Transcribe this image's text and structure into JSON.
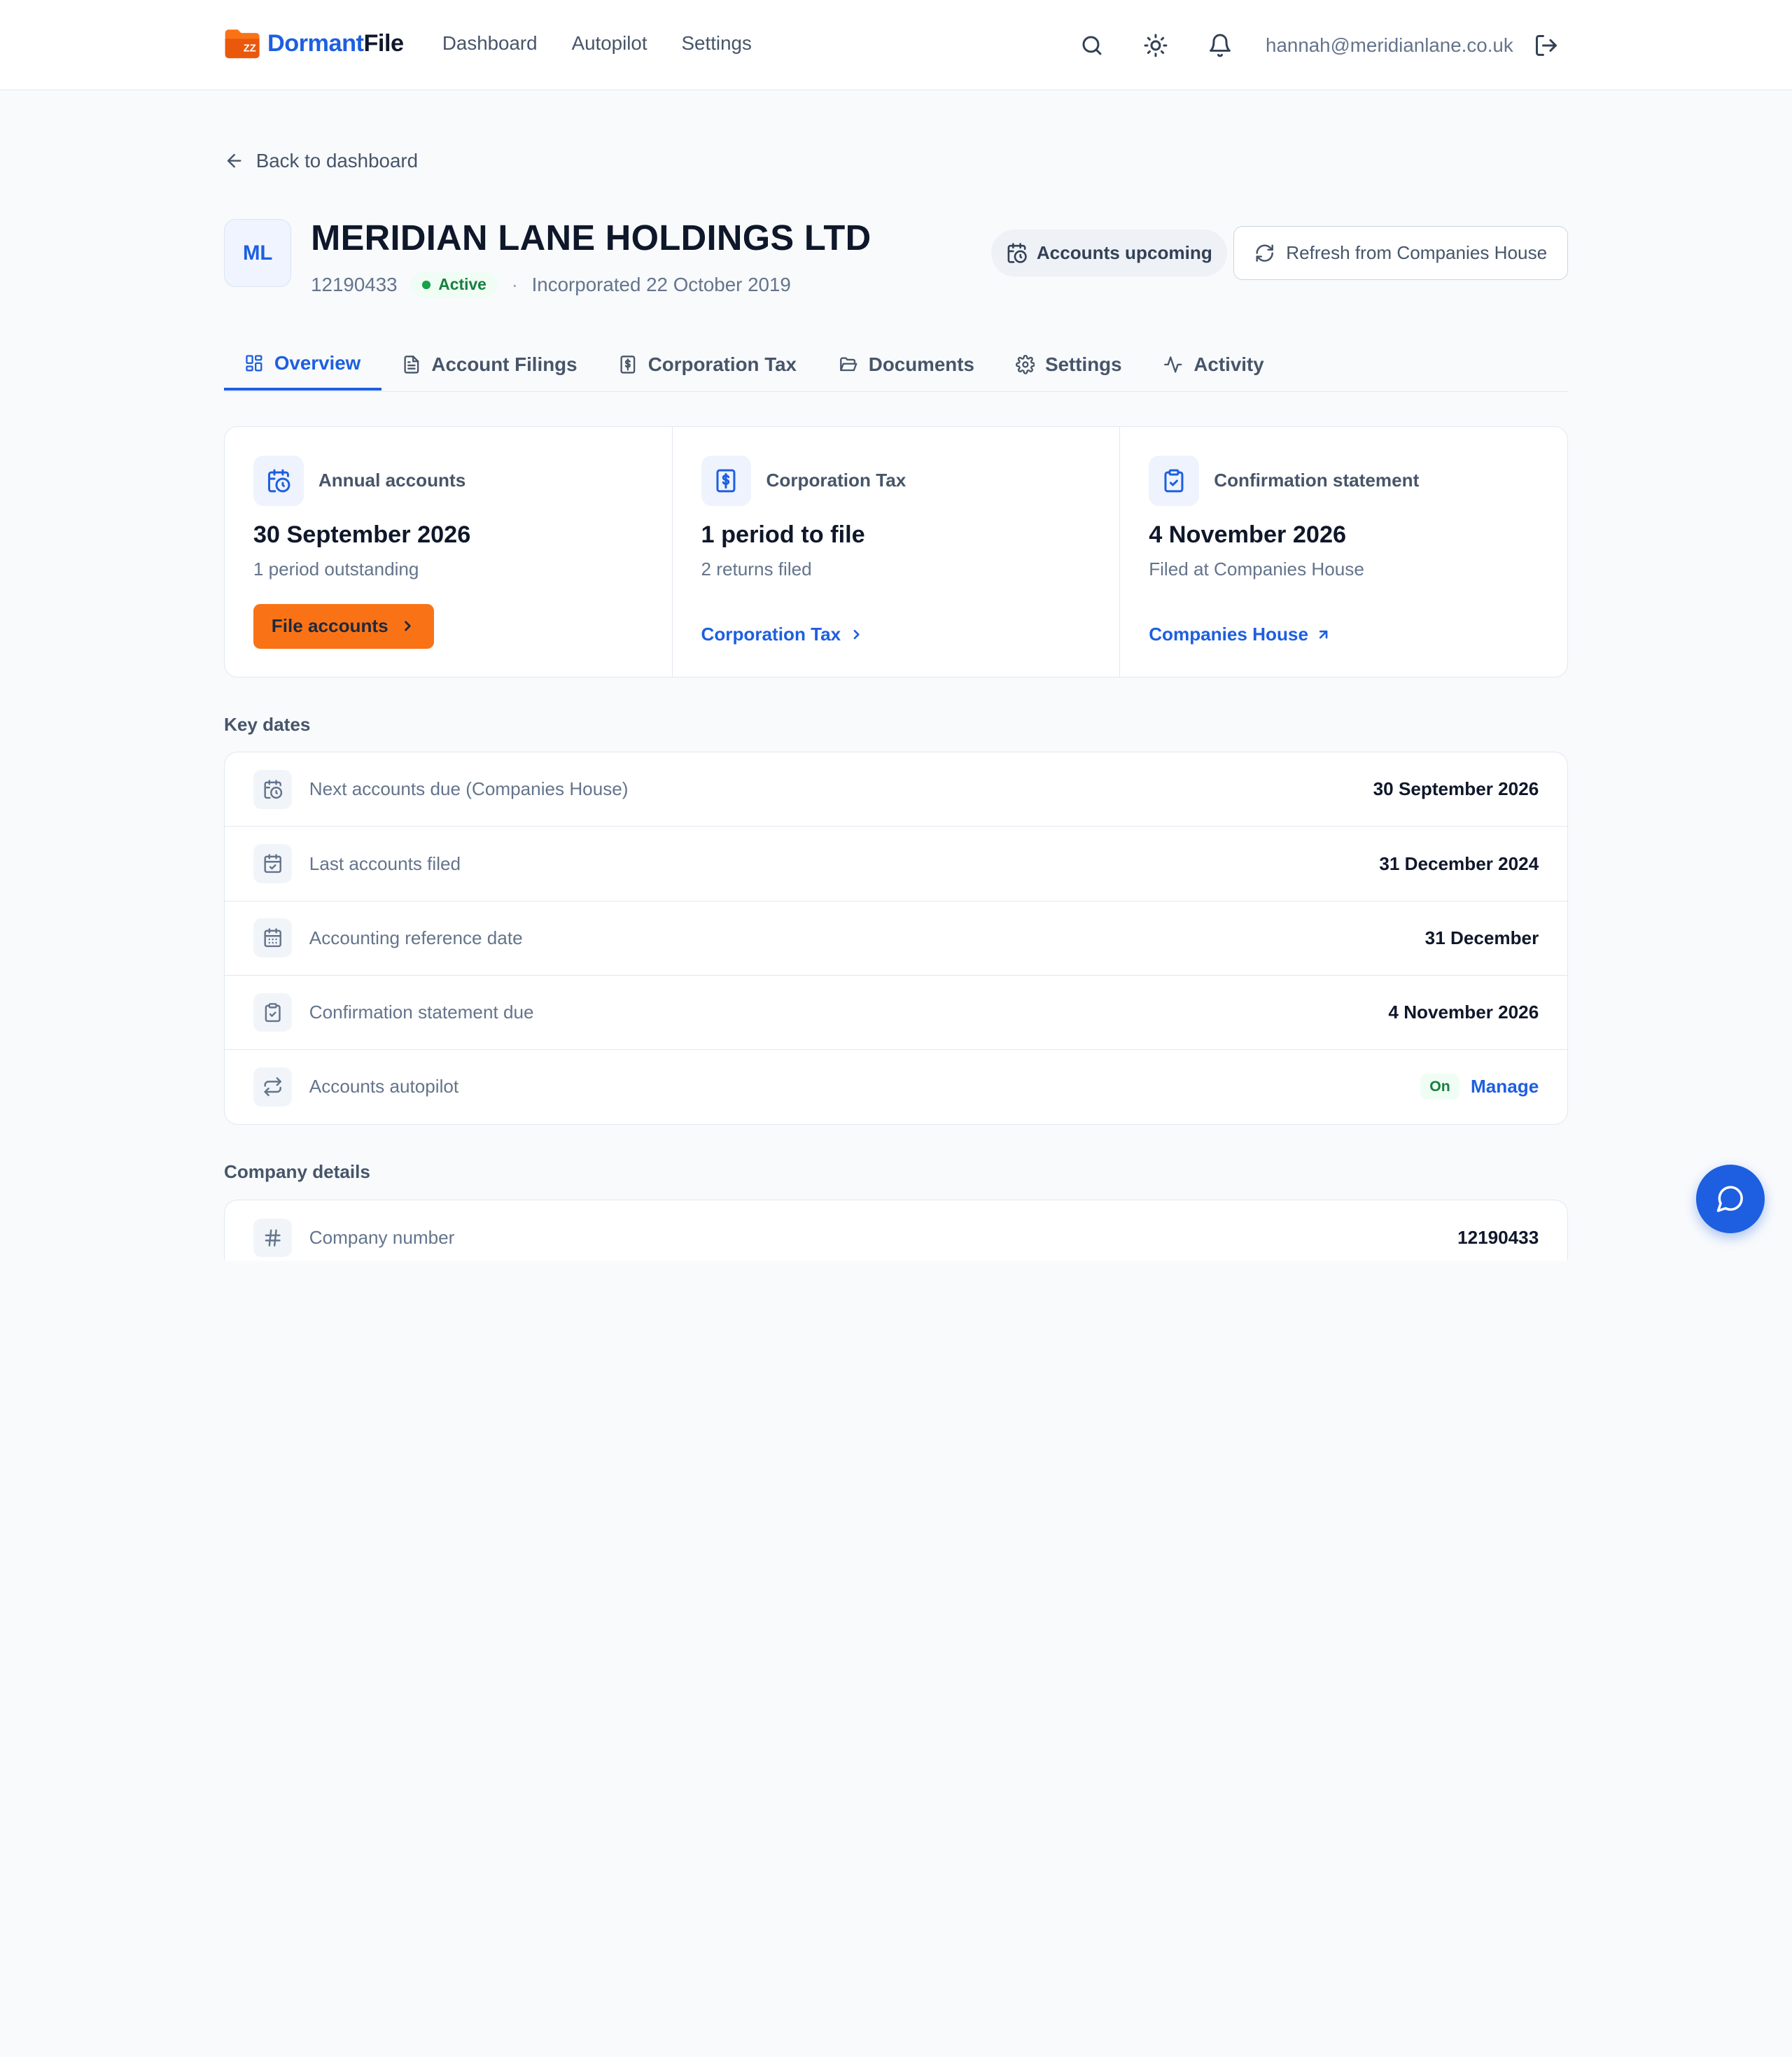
{
  "brand": {
    "name_part1": "Dormant",
    "name_part2": "File",
    "logo_text": "ZZ"
  },
  "nav": {
    "items": [
      "Dashboard",
      "Autopilot",
      "Settings"
    ]
  },
  "user": {
    "email": "hannah@meridianlane.co.uk"
  },
  "back_link": "Back to dashboard",
  "company": {
    "initials": "ML",
    "name": "MERIDIAN LANE HOLDINGS LTD",
    "number": "12190433",
    "status": "Active",
    "incorporated": "Incorporated 22 October 2019",
    "badge": "Accounts upcoming",
    "refresh_label": "Refresh from Companies House"
  },
  "tabs": [
    "Overview",
    "Account Filings",
    "Corporation Tax",
    "Documents",
    "Settings",
    "Activity"
  ],
  "cards": {
    "annual": {
      "label": "Annual accounts",
      "value": "30 September 2026",
      "sub": "1 period outstanding",
      "action": "File accounts"
    },
    "ct": {
      "label": "Corporation Tax",
      "value": "1 period to file",
      "sub": "2 returns filed",
      "link": "Corporation Tax"
    },
    "cs": {
      "label": "Confirmation statement",
      "value": "4 November 2026",
      "sub": "Filed at Companies House",
      "link": "Companies House"
    }
  },
  "key_dates": {
    "title": "Key dates",
    "rows": [
      {
        "label": "Next accounts due (Companies House)",
        "value": "30 September 2026"
      },
      {
        "label": "Last accounts filed",
        "value": "31 December 2024"
      },
      {
        "label": "Accounting reference date",
        "value": "31 December"
      },
      {
        "label": "Confirmation statement due",
        "value": "4 November 2026"
      },
      {
        "label": "Accounts autopilot",
        "status": "On",
        "action": "Manage"
      }
    ]
  },
  "company_details": {
    "title": "Company details",
    "rows": [
      {
        "label": "Company number",
        "value": "12190433"
      }
    ]
  }
}
